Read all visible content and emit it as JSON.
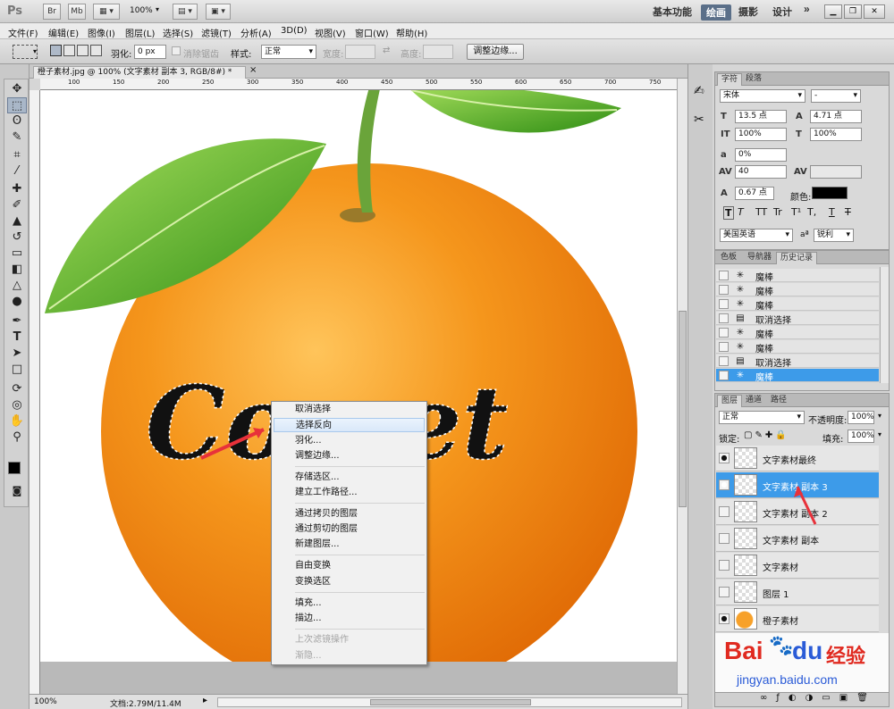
{
  "appbar": {
    "logo": "Ps",
    "br": "Br",
    "mb": "Mb",
    "zoom": "100%",
    "workspaces": [
      "基本功能",
      "绘画",
      "摄影",
      "设计"
    ],
    "more": "»"
  },
  "menus": [
    "文件(F)",
    "编辑(E)",
    "图像(I)",
    "图层(L)",
    "选择(S)",
    "滤镜(T)",
    "分析(A)",
    "3D(D)",
    "视图(V)",
    "窗口(W)",
    "帮助(H)"
  ],
  "options": {
    "feather_label": "羽化:",
    "feather_value": "0 px",
    "antialias_label": "消除锯齿",
    "style_label": "样式:",
    "style_value": "正常",
    "width_label": "宽度:",
    "height_label": "高度:",
    "refine_button": "调整边缘..."
  },
  "document": {
    "tab_title": "橙子素材.jpg @ 100% (文字素材 副本 3, RGB/8#) *",
    "close": "×",
    "ruler_ticks": [
      "100",
      "150",
      "200",
      "250",
      "300",
      "350",
      "400",
      "450",
      "500",
      "550",
      "600",
      "650",
      "700",
      "750"
    ],
    "status_zoom": "100%",
    "status_doc": "文档:2.79M/11.4M",
    "canvas_text": "Comet"
  },
  "context_menu": {
    "groups": [
      [
        "取消选择",
        "选择反向",
        "羽化...",
        "调整边缘..."
      ],
      [
        "存储选区...",
        "建立工作路径..."
      ],
      [
        "通过拷贝的图层",
        "通过剪切的图层",
        "新建图层..."
      ],
      [
        "自由变换",
        "变换选区"
      ],
      [
        "填充...",
        "描边..."
      ],
      [
        "上次滤镜操作",
        "渐隐..."
      ]
    ],
    "highlighted": "选择反向",
    "disabled": [
      "上次滤镜操作",
      "渐隐..."
    ]
  },
  "character_panel": {
    "tabs": [
      "字符",
      "段落"
    ],
    "font": "宋体",
    "font_style": "-",
    "size": "13.5 点",
    "leading": "4.71 点",
    "vscale": "100%",
    "hscale": "100%",
    "baseline": "0%",
    "tracking": "40",
    "shift": "0.67 点",
    "color_label": "颜色:",
    "language": "美国英语",
    "aa_label": "a",
    "antialias": "锐利",
    "style_buttons": [
      "T",
      "T",
      "TT",
      "Tr",
      "T¹",
      "T,",
      "T",
      "T"
    ]
  },
  "history_panel": {
    "tabs": [
      "色板",
      "导航器",
      "历史记录"
    ],
    "items": [
      "魔棒",
      "魔棒",
      "魔棒",
      "取消选择",
      "魔棒",
      "魔棒",
      "取消选择",
      "魔棒"
    ],
    "selected_index": 7
  },
  "layers_panel": {
    "tabs": [
      "图层",
      "通道",
      "路径"
    ],
    "blend_mode": "正常",
    "opacity_label": "不透明度:",
    "opacity": "100%",
    "lock_label": "锁定:",
    "fill_label": "填充:",
    "fill": "100%",
    "layers": [
      "文字素材最终",
      "文字素材 副本 3",
      "文字素材 副本 2",
      "文字素材 副本",
      "文字素材",
      "图层 1",
      "橙子素材"
    ],
    "selected_index": 1,
    "visible": [
      true,
      true,
      false,
      false,
      false,
      false,
      true
    ]
  },
  "watermark": {
    "brand": "Bai",
    "brand2": "du",
    "subtitle": "经验",
    "url": "jingyan.baidu.com"
  },
  "colors": {
    "accent": "#3d9be9",
    "orange": "#f28b12",
    "leaf": "#3d9a1f"
  }
}
